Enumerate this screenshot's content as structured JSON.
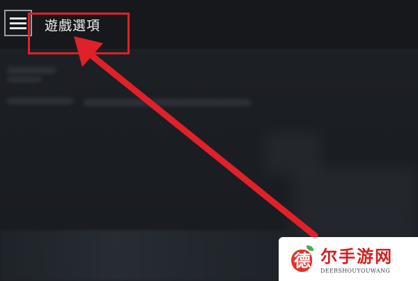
{
  "header": {
    "title": "遊戲選項",
    "menu_icon": "hamburger-menu-icon"
  },
  "annotation": {
    "box_color": "#e0212a",
    "arrow_color": "#e0212a"
  },
  "watermark": {
    "logo_glyph": "德",
    "site_name": "尔手游网",
    "site_domain": "DEERSHOUYOUWANG",
    "brand_color": "#d0201f"
  }
}
